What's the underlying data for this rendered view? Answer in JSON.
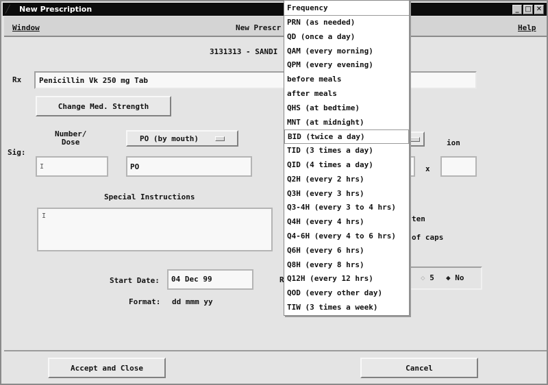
{
  "window": {
    "title": "New Prescription",
    "controls": {
      "minimize": "_",
      "maximize": "□",
      "close": "✕"
    }
  },
  "menubar": {
    "window_menu": "Window",
    "center_title": "New Prescr",
    "help_menu": "Help"
  },
  "patient": {
    "label": "3131313 - SANDI"
  },
  "rx": {
    "label": "Rx",
    "value": "Penicillin Vk 250 mg Tab",
    "change_strength_button": "Change Med. Strength"
  },
  "sig": {
    "label": "Sig:",
    "number_dose_label": "Number/\nDose",
    "number_dose_value": "",
    "route_select": "PO (by mouth)",
    "route_value": "PO",
    "duration_label_partial": "ion",
    "times_symbol": "x",
    "duration_value": ""
  },
  "special_instructions": {
    "label": "Special Instructions",
    "value": ""
  },
  "side_text": {
    "line1_partial": "ten",
    "line2_partial": "of caps"
  },
  "start_date": {
    "label": "Start Date:",
    "value": "04 Dec 99",
    "format_label": "Format:",
    "format_value": "dd mmm yy"
  },
  "refills": {
    "label_partial": "R",
    "options": [
      {
        "label": "5",
        "selected": false
      },
      {
        "label": "No",
        "selected": true
      }
    ]
  },
  "frequency_dropdown": {
    "header": "Frequency",
    "selected_index": 8,
    "options": [
      "PRN (as needed)",
      "QD (once a day)",
      "QAM (every morning)",
      "QPM (every evening)",
      "before meals",
      "after meals",
      "QHS (at bedtime)",
      "MNT (at midnight)",
      "BID (twice a day)",
      "TID (3 times a day)",
      "QID (4 times a day)",
      "Q2H (every 2 hrs)",
      "Q3H (every 3 hrs)",
      "Q3-4H (every 3 to 4 hrs)",
      "Q4H (every 4 hrs)",
      "Q4-6H (every 4 to 6 hrs)",
      "Q6H (every 6 hrs)",
      "Q8H (every 8 hrs)",
      "Q12H (every 12 hrs)",
      "QOD (every other day)",
      "TIW (3 times a week)"
    ]
  },
  "footer": {
    "accept_button": "Accept and Close",
    "cancel_button": "Cancel"
  }
}
